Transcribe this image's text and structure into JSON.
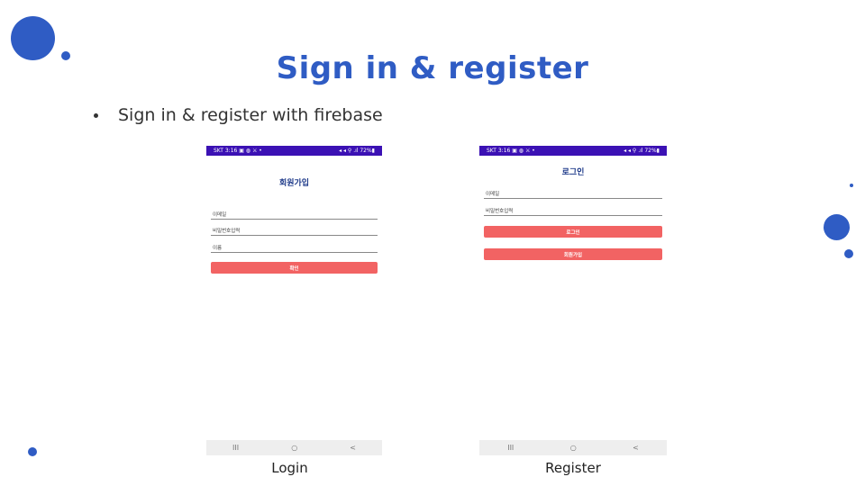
{
  "slide": {
    "title": "Sign in & register",
    "bullet": "Sign in & register  with firebase"
  },
  "login_phone": {
    "status_left": "SKT 3:16 ▣ ◍ ⚔ •",
    "status_right": "◂ ◂ ⚲ .ıl 72%▮",
    "screen_title": "회원가입",
    "fields": [
      "이메일",
      "비밀번호입력",
      "이름"
    ],
    "button": "확인",
    "nav": [
      "III",
      "○",
      "<"
    ],
    "caption": "Login"
  },
  "register_phone": {
    "status_left": "SKT 3:16 ▣ ◍ ⚔ •",
    "status_right": "◂ ◂ ⚲ .ıl 72%▮",
    "screen_title": "로그인",
    "fields": [
      "이메일",
      "비밀번호입력"
    ],
    "buttons": [
      "로그인",
      "회원가입"
    ],
    "nav": [
      "III",
      "○",
      "<"
    ],
    "caption": "Register"
  },
  "colors": {
    "accent": "#2f5cc4",
    "statusbar": "#3b11b4",
    "button": "#f26363"
  }
}
